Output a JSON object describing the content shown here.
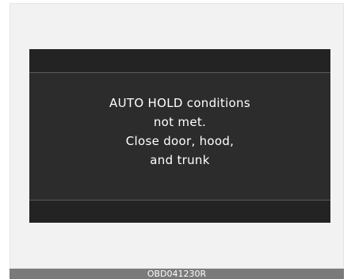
{
  "display": {
    "message_lines": [
      "AUTO HOLD conditions",
      "not met.",
      "Close door, hood,",
      "and trunk"
    ]
  },
  "figure_code": "OBD041230R"
}
